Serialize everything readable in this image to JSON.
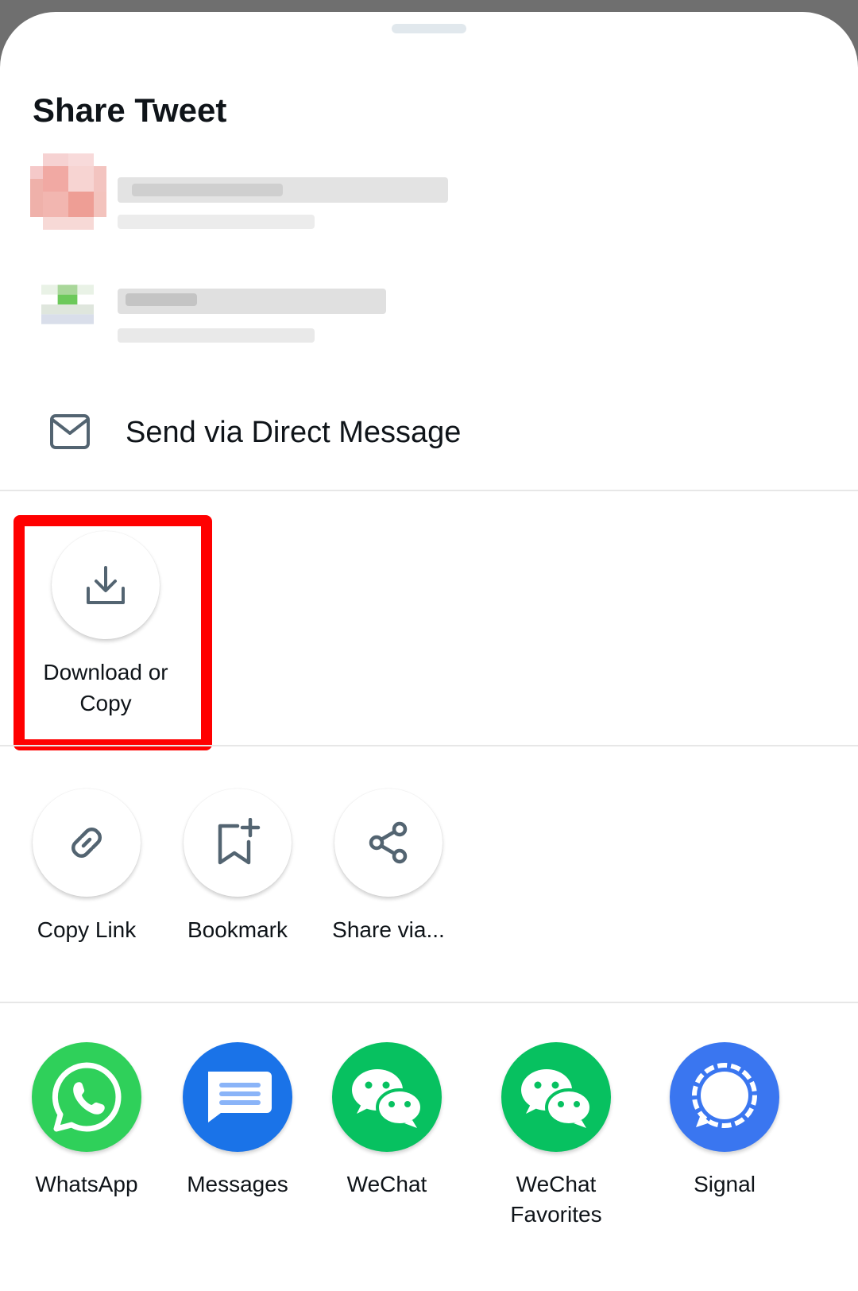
{
  "sheet": {
    "title": "Share Tweet"
  },
  "direct_message": {
    "label": "Send via Direct Message",
    "icon": "mail-icon"
  },
  "primary_action": {
    "label": "Download or Copy",
    "icon": "download-icon"
  },
  "actions": [
    {
      "label": "Copy Link",
      "icon": "link-icon"
    },
    {
      "label": "Bookmark",
      "icon": "bookmark-add-icon"
    },
    {
      "label": "Share via...",
      "icon": "share-icon"
    }
  ],
  "apps": [
    {
      "label": "WhatsApp",
      "icon": "whatsapp-icon",
      "color": "#2fd05a"
    },
    {
      "label": "Messages",
      "icon": "messages-icon",
      "color": "#1a73e8"
    },
    {
      "label": "WeChat",
      "icon": "wechat-icon",
      "color": "#07c160"
    },
    {
      "label": "WeChat Favorites",
      "icon": "wechat-favorites-icon",
      "color": "#07c160"
    },
    {
      "label": "Signal",
      "icon": "signal-icon",
      "color": "#3a76f0"
    }
  ],
  "colors": {
    "highlight": "#ff0000",
    "text": "#0f1419",
    "icon_gray": "#536471"
  }
}
